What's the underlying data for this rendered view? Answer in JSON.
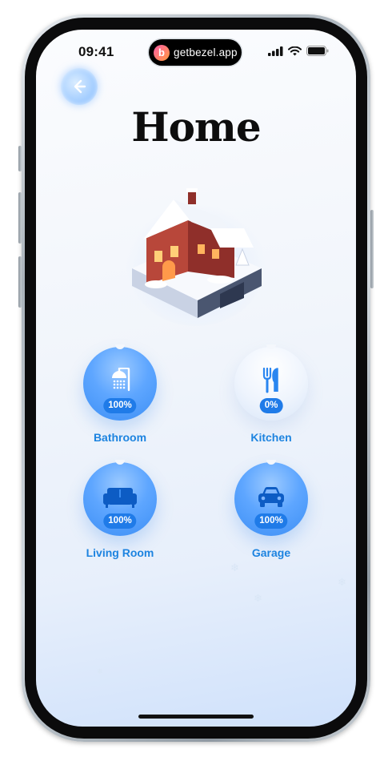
{
  "status": {
    "time": "09:41",
    "island_text": "getbezel.app",
    "island_logo": "b"
  },
  "header": {
    "title": "Home",
    "back_icon": "back-arrow-icon"
  },
  "rooms": [
    {
      "label": "Bathroom",
      "percent": "100%",
      "icon": "shower-icon",
      "active": true
    },
    {
      "label": "Kitchen",
      "percent": "0%",
      "icon": "utensils-icon",
      "active": false
    },
    {
      "label": "Living Room",
      "percent": "100%",
      "icon": "sofa-icon",
      "active": true
    },
    {
      "label": "Garage",
      "percent": "100%",
      "icon": "car-icon",
      "active": true
    }
  ],
  "colors": {
    "accent": "#1d84e0",
    "pill": "#1f7be8"
  }
}
